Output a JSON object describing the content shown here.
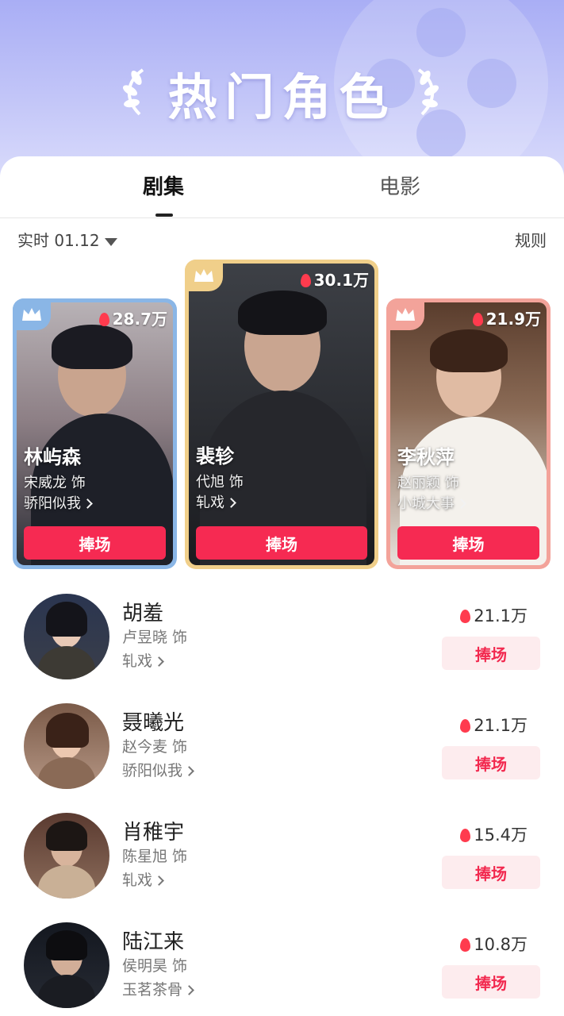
{
  "banner": {
    "title": "热门角色"
  },
  "tabs": [
    {
      "label": "剧集"
    },
    {
      "label": "电影"
    }
  ],
  "filter": {
    "label": "实时 01.12"
  },
  "rules_label": "规则",
  "top3": [
    {
      "rank": 2,
      "character": "林屿森",
      "actor": "宋威龙 饰",
      "show": "骄阳似我",
      "heat": "28.7万",
      "boost_label": "捧场",
      "frame_color": "#8ab6e6"
    },
    {
      "rank": 1,
      "character": "裴轸",
      "actor": "代旭 饰",
      "show": "轧戏",
      "heat": "30.1万",
      "boost_label": "捧场",
      "frame_color": "#f0cf8a"
    },
    {
      "rank": 3,
      "character": "李秋萍",
      "actor": "赵丽颖 饰",
      "show": "小城大事",
      "heat": "21.9万",
      "boost_label": "捧场",
      "frame_color": "#f3a39a"
    }
  ],
  "list": [
    {
      "character": "胡羞",
      "actor": "卢昱晓 饰",
      "show": "轧戏",
      "heat": "21.1万",
      "boost_label": "捧场"
    },
    {
      "character": "聂曦光",
      "actor": "赵今麦 饰",
      "show": "骄阳似我",
      "heat": "21.1万",
      "boost_label": "捧场"
    },
    {
      "character": "肖稚宇",
      "actor": "陈星旭 饰",
      "show": "轧戏",
      "heat": "15.4万",
      "boost_label": "捧场"
    },
    {
      "character": "陆江来",
      "actor": "侯明昊 饰",
      "show": "玉茗茶骨",
      "heat": "10.8万",
      "boost_label": "捧场"
    }
  ],
  "colors": {
    "accent": "#f62a52",
    "banner": "#a9aef5"
  }
}
